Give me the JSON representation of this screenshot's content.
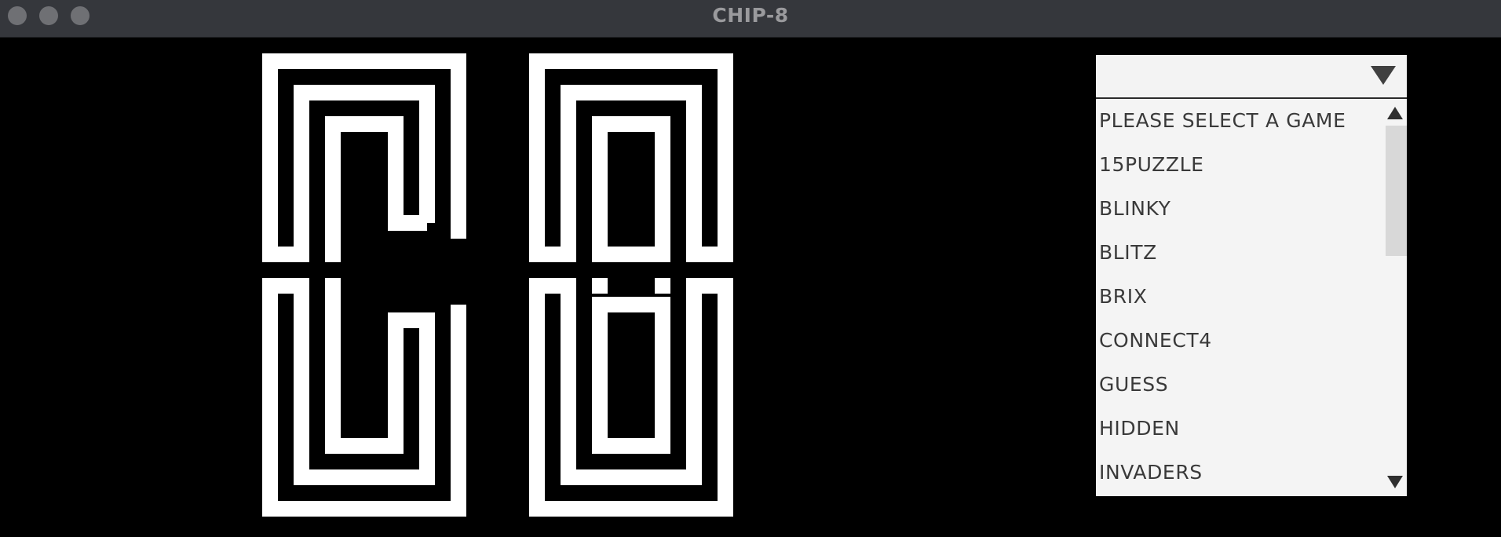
{
  "window": {
    "title": "CHIP-8"
  },
  "screen": {
    "logo_text": "C8",
    "foreground": "#ffffff",
    "background": "#000000"
  },
  "game_selector": {
    "selected_value": "",
    "items": [
      {
        "label": "PLEASE SELECT A GAME"
      },
      {
        "label": "15PUZZLE"
      },
      {
        "label": "BLINKY"
      },
      {
        "label": "BLITZ"
      },
      {
        "label": "BRIX"
      },
      {
        "label": "CONNECT4"
      },
      {
        "label": "GUESS"
      },
      {
        "label": "HIDDEN"
      },
      {
        "label": "INVADERS"
      }
    ]
  }
}
